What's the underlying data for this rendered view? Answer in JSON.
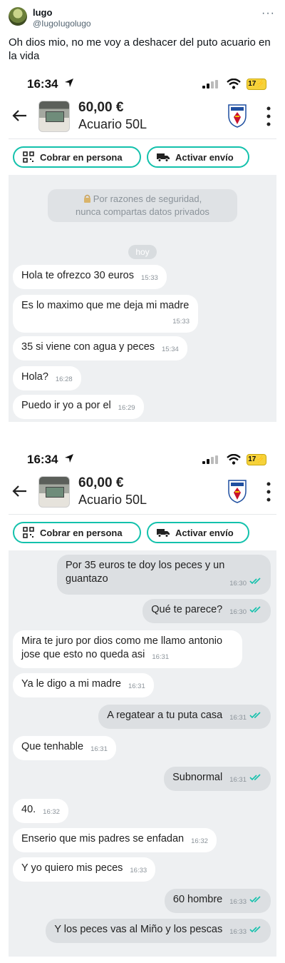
{
  "tweet": {
    "name": "lugo",
    "handle": "@IugoIugolugo",
    "more": "···",
    "text": "Oh dios mio, no me voy a deshacer del puto acuario en la vida"
  },
  "phone": {
    "time": "16:34",
    "battery": "17",
    "listing": {
      "price": "60,00 €",
      "title": "Acuario 50L"
    },
    "actions": {
      "cobrar": "Cobrar en persona",
      "envio": "Activar envío"
    },
    "accent_color": "#13c1ac"
  },
  "chat1": {
    "notice_line1": "Por razones de seguridad,",
    "notice_line2": "nunca compartas datos privados",
    "day": "hoy",
    "messages": [
      {
        "dir": "in",
        "text": "Hola te ofrezco 30 euros",
        "time": "15:33"
      },
      {
        "dir": "in",
        "text": "Es lo maximo que me deja mi madre",
        "time": "15:33"
      },
      {
        "dir": "in",
        "text": "35 si viene con agua y peces",
        "time": "15:34"
      },
      {
        "dir": "in",
        "text": "Hola?",
        "time": "16:28"
      },
      {
        "dir": "in",
        "text": "Puedo ir yo a por el",
        "time": "16:29"
      }
    ]
  },
  "chat2": {
    "messages": [
      {
        "dir": "out",
        "text": "Por 35 euros te doy los peces y un guantazo",
        "time": "16:30"
      },
      {
        "dir": "out",
        "text": "Qué te parece?",
        "time": "16:30"
      },
      {
        "dir": "in",
        "text": "Mira te juro por dios como me llamo antonio jose que esto no queda asi",
        "time": "16:31"
      },
      {
        "dir": "in",
        "text": "Ya le digo a mi madre",
        "time": "16:31"
      },
      {
        "dir": "out",
        "text": "A regatear a tu puta casa",
        "time": "16:31"
      },
      {
        "dir": "in",
        "text": "Que tenhable",
        "time": "16:31"
      },
      {
        "dir": "out",
        "text": "Subnormal",
        "time": "16:31"
      },
      {
        "dir": "in",
        "text": "40.",
        "time": "16:32"
      },
      {
        "dir": "in",
        "text": "Enserio que mis padres se enfadan",
        "time": "16:32"
      },
      {
        "dir": "in",
        "text": "Y yo quiero mis peces",
        "time": "16:33"
      },
      {
        "dir": "out",
        "text": "60 hombre",
        "time": "16:33"
      },
      {
        "dir": "out",
        "text": "Y los peces vas al Miño y los pescas",
        "time": "16:33"
      }
    ]
  }
}
